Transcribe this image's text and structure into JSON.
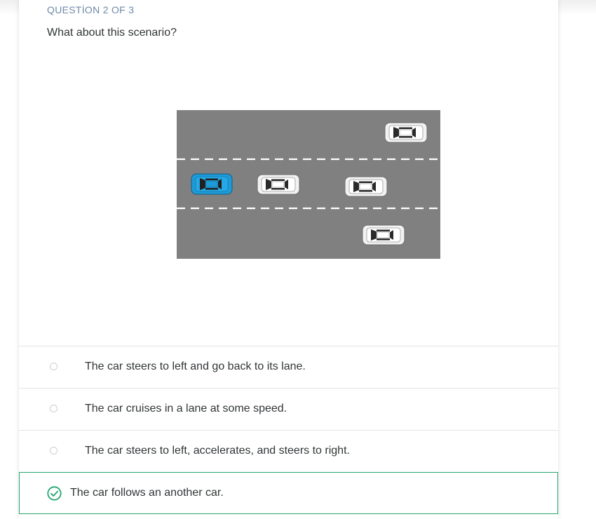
{
  "question": {
    "counter": "QUESTİON 2 OF 3",
    "prompt": "What about this scenario?"
  },
  "scenario_image": {
    "road_color": "#808080",
    "lane_marking_color": "#ffffff",
    "ego_car_color": "#1e9ad6",
    "other_car_color": "#f2f2f2"
  },
  "options": [
    {
      "label": "The car steers to left and go back to its lane.",
      "state": "unselected"
    },
    {
      "label": "The car cruises in a lane at some speed.",
      "state": "unselected"
    },
    {
      "label": "The car steers to left, accelerates, and steers to right.",
      "state": "unselected"
    },
    {
      "label": "The car follows an another car.",
      "state": "correct"
    }
  ],
  "colors": {
    "accent_correct": "#26a671",
    "counter_text": "#6f8aa7",
    "body_text": "#313537"
  }
}
